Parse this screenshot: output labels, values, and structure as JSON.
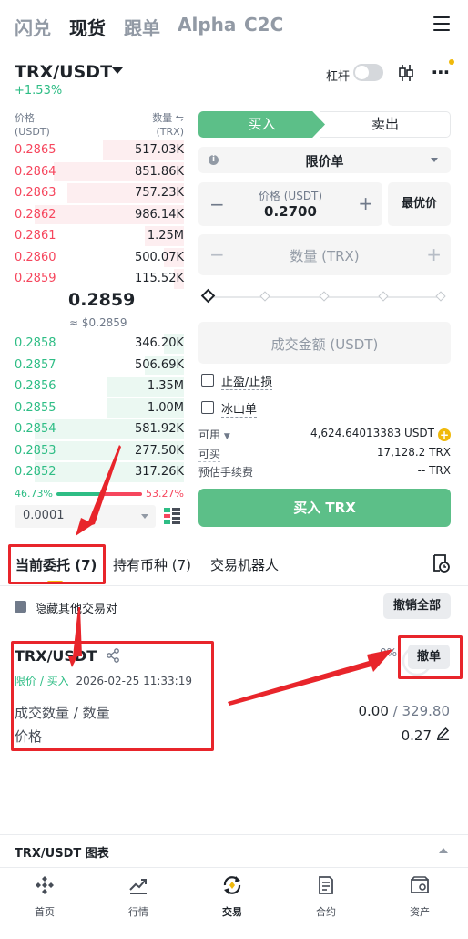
{
  "top_tabs": [
    "闪兑",
    "现货",
    "跟单",
    "Alpha",
    "C2C"
  ],
  "active_top_tab": "现货",
  "pair": {
    "symbol": "TRX/USDT",
    "change": "+1.53%",
    "margin_label": "杠杆"
  },
  "orderbook": {
    "price_header": "价格",
    "price_unit": "(USDT)",
    "qty_header": "数量",
    "qty_unit": "(TRX)",
    "asks": [
      {
        "price": "0.2865",
        "qty": "517.03K",
        "depth": 0.48
      },
      {
        "price": "0.2864",
        "qty": "851.86K",
        "depth": 0.77
      },
      {
        "price": "0.2863",
        "qty": "757.23K",
        "depth": 0.69
      },
      {
        "price": "0.2862",
        "qty": "986.14K",
        "depth": 0.88
      },
      {
        "price": "0.2861",
        "qty": "1.25M",
        "depth": 0.23
      },
      {
        "price": "0.2860",
        "qty": "500.07K",
        "depth": 0.12
      },
      {
        "price": "0.2859",
        "qty": "115.52K",
        "depth": 0.06
      }
    ],
    "mid_price": "0.2859",
    "mid_usd": "≈ $0.2859",
    "bids": [
      {
        "price": "0.2858",
        "qty": "346.20K",
        "depth": 0.12
      },
      {
        "price": "0.2857",
        "qty": "506.69K",
        "depth": 0.23
      },
      {
        "price": "0.2856",
        "qty": "1.35M",
        "depth": 0.45
      },
      {
        "price": "0.2855",
        "qty": "1.00M",
        "depth": 0.45
      },
      {
        "price": "0.2854",
        "qty": "581.92K",
        "depth": 0.88
      },
      {
        "price": "0.2853",
        "qty": "277.50K",
        "depth": 0.88
      },
      {
        "price": "0.2852",
        "qty": "317.26K",
        "depth": 0.88
      }
    ],
    "buy_ratio": "46.73%",
    "sell_ratio": "53.27%",
    "precision": "0.0001"
  },
  "form": {
    "buy_tab": "买入",
    "sell_tab": "卖出",
    "order_type": "限价单",
    "price_label": "价格 (USDT)",
    "price_value": "0.2700",
    "best_price": "最优价",
    "qty_placeholder": "数量 (TRX)",
    "total_placeholder": "成交金额 (USDT)",
    "tp_sl": "止盈/止损",
    "iceberg": "冰山单",
    "available_label": "可用",
    "available_value": "4,624.64013383 USDT",
    "can_buy_label": "可买",
    "can_buy_value": "17,128.2 TRX",
    "fee_label": "预估手续费",
    "fee_value": "-- TRX",
    "buy_button": "买入 TRX"
  },
  "order_tabs": [
    "当前委托 (7)",
    "持有币种 (7)",
    "交易机器人"
  ],
  "hide_others": "隐藏其他交易对",
  "cancel_all": "撤销全部",
  "order": {
    "pair": "TRX/USDT",
    "type": "限价 / 买入",
    "time": "2026-02-25 11:33:19",
    "fill_pct": "0%",
    "cancel": "撤单",
    "qty_label": "成交数量 / 数量",
    "filled": "0.00",
    "separator": "/",
    "total": "329.80",
    "price_label": "价格",
    "price": "0.27"
  },
  "chart_label": "TRX/USDT 图表",
  "bottom_nav": [
    {
      "label": "首页",
      "icon": "home-icon"
    },
    {
      "label": "行情",
      "icon": "markets-icon"
    },
    {
      "label": "交易",
      "icon": "trade-icon"
    },
    {
      "label": "合约",
      "icon": "futures-icon"
    },
    {
      "label": "资产",
      "icon": "wallet-icon"
    }
  ],
  "colors": {
    "buy": "#2ebd85",
    "sell": "#f6465d",
    "accent": "#f0b90b",
    "annotation": "#e8252b"
  }
}
